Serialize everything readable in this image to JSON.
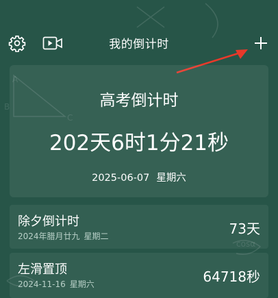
{
  "header": {
    "title": "我的倒计时",
    "left_icons": [
      "gear-icon",
      "video-icon"
    ],
    "right_icon": "plus-icon"
  },
  "main_card": {
    "title": "高考倒计时",
    "remaining": "202天6时1分21秒",
    "date": "2025-06-07",
    "weekday": "星期六"
  },
  "list": [
    {
      "name": "除夕倒计时",
      "date": "2024年腊月廿九",
      "weekday": "星期二",
      "value": "73天"
    },
    {
      "name": "左滑置顶",
      "date": "2024-11-16",
      "weekday": "星期六",
      "value": "64718秒"
    }
  ],
  "colors": {
    "background": "#275548",
    "annotation_arrow": "#e8392a"
  }
}
